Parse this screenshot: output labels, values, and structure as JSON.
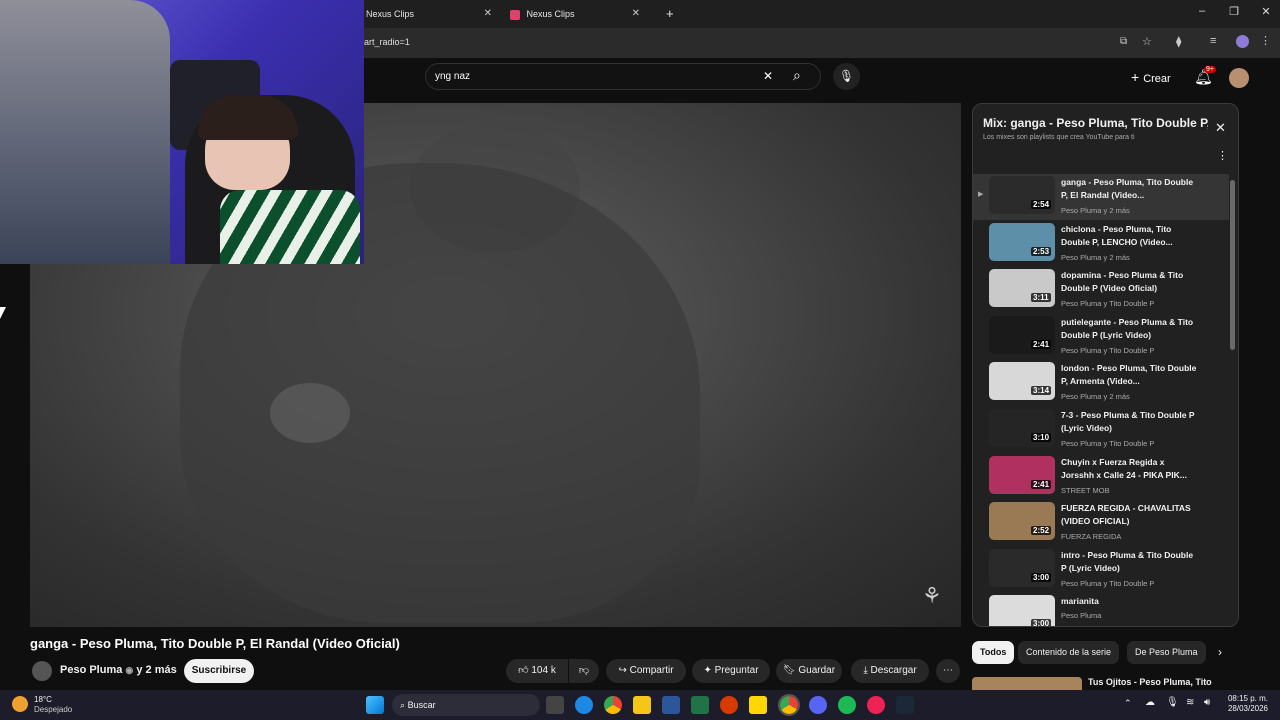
{
  "browser": {
    "tabs": [
      {
        "label": "Nexus Clips"
      },
      {
        "label": "Nexus Clips"
      }
    ],
    "url": "art_radio=1",
    "new_tab_symbol": "+"
  },
  "yt_header": {
    "search_value": "yng naz",
    "create_label": "Crear",
    "notifications_badge": "9+"
  },
  "video": {
    "title": "ganga - Peso Pluma, Tito Double P, El Randal (Video Oficial)",
    "channel": "Peso Pluma",
    "channel_more": "y 2 más",
    "subscribe_label": "Suscribirse",
    "likes": "104 k",
    "share_label": "Compartir",
    "ask_label": "Preguntar",
    "save_label": "Guardar",
    "download_label": "Descargar"
  },
  "mix": {
    "title": "Mix: ganga - Peso Pluma, Tito Double P, El Randal",
    "subtitle": "Los mixes son playlists que crea YouTube para ti",
    "items": [
      {
        "title": "ganga - Peso Pluma, Tito Double P, El Randal (Video...",
        "artist": "Peso Pluma y 2 más",
        "duration": "2:54",
        "color": "#2b2b2b"
      },
      {
        "title": "chiclona - Peso Pluma, Tito Double P, LENCHO (Video...",
        "artist": "Peso Pluma y 2 más",
        "duration": "2:53",
        "color": "#5d8fa8"
      },
      {
        "title": "dopamina - Peso Pluma & Tito Double P (Video Oficial)",
        "artist": "Peso Pluma y Tito Double P",
        "duration": "3:11",
        "color": "#c9c9c9"
      },
      {
        "title": "putielegante - Peso Pluma & Tito Double P (Lyric Video)",
        "artist": "Peso Pluma y Tito Double P",
        "duration": "2:41",
        "color": "#1a1a1a"
      },
      {
        "title": "london - Peso Pluma, Tito Double P, Armenta (Video...",
        "artist": "Peso Pluma y 2 más",
        "duration": "3:14",
        "color": "#d8d8d8"
      },
      {
        "title": "7-3 - Peso Pluma & Tito Double P (Lyric Video)",
        "artist": "Peso Pluma y Tito Double P",
        "duration": "3:10",
        "color": "#252525"
      },
      {
        "title": "Chuyin x Fuerza Regida x Jorsshh x Calle 24 - PIKA PIK...",
        "artist": "STREET MOB",
        "duration": "2:41",
        "color": "#b03060"
      },
      {
        "title": "FUERZA REGIDA - CHAVALITAS (VIDEO OFICIAL)",
        "artist": "FUERZA REGIDA",
        "duration": "2:52",
        "color": "#9a7a55"
      },
      {
        "title": "intro - Peso Pluma & Tito Double P (Lyric Video)",
        "artist": "Peso Pluma y Tito Double P",
        "duration": "3:00",
        "color": "#2a2a2a"
      },
      {
        "title": "marianita",
        "artist": "Peso Pluma",
        "duration": "3:00",
        "color": "#dcdcdc"
      }
    ]
  },
  "chips": [
    "Todos",
    "Contenido de la serie",
    "De Peso Pluma"
  ],
  "next_video_title": "Tus Ojitos - Peso Pluma, Tito",
  "taskbar": {
    "temperature": "18°C",
    "weather": "Despejado",
    "search_label": "Buscar",
    "time": "08:15 p. m.",
    "date": "28/03/2026"
  }
}
